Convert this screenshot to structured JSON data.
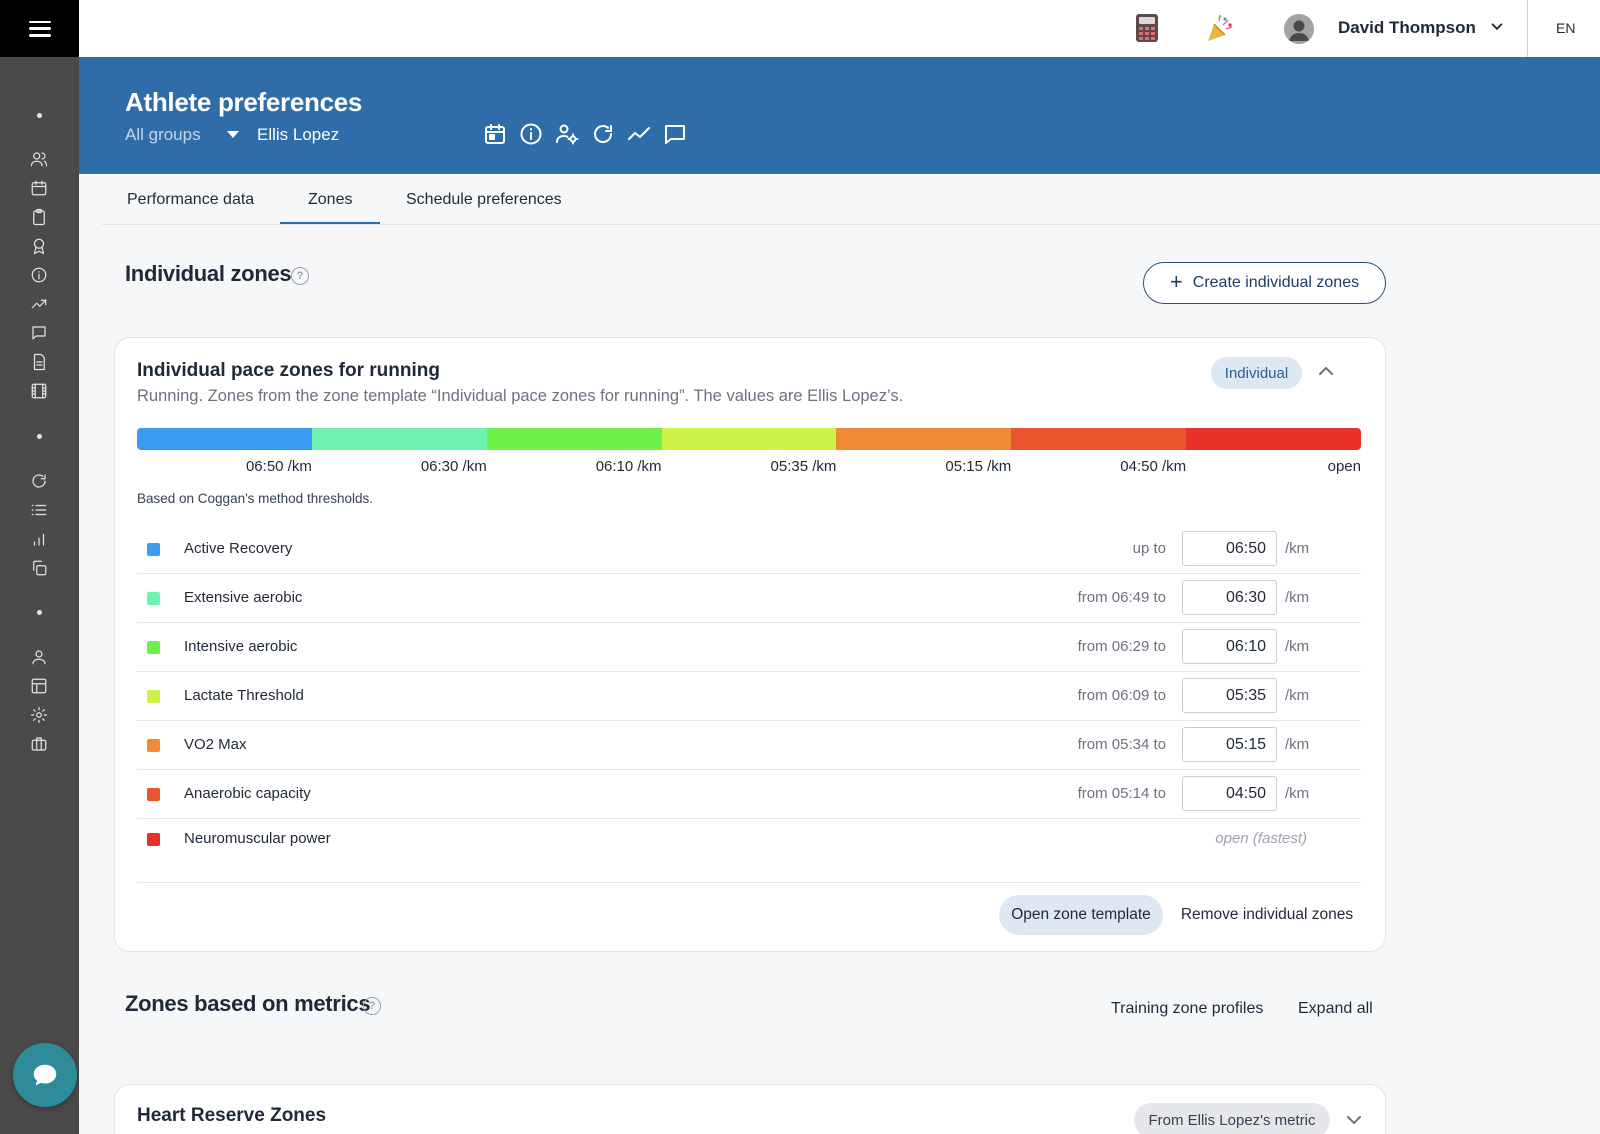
{
  "topbar": {
    "calculator_icon": "calculator-icon",
    "party_icon": "party-popper-icon",
    "user_name": "David Thompson",
    "language": "EN"
  },
  "header": {
    "title": "Athlete preferences",
    "group_select": "All groups",
    "athlete": "Ellis Lopez",
    "icons": [
      "calendar-icon",
      "info-icon",
      "user-settings-icon",
      "refresh-icon",
      "trend-icon",
      "comment-icon"
    ]
  },
  "tabs": [
    {
      "label": "Performance data",
      "active": false
    },
    {
      "label": "Zones",
      "active": true
    },
    {
      "label": "Schedule preferences",
      "active": false
    }
  ],
  "individual_zones": {
    "title": "Individual zones",
    "help": "?",
    "create_button": "Create individual zones",
    "card": {
      "title": "Individual pace zones for running",
      "subtitle": "Running. Zones from the zone template “Individual pace zones for running”. The values are Ellis Lopez’s.",
      "badge": "Individual",
      "bar_labels": [
        "06:50 /km",
        "06:30 /km",
        "06:10 /km",
        "05:35 /km",
        "05:15 /km",
        "04:50 /km",
        "open"
      ],
      "method_note": "Based on Coggan's method thresholds.",
      "zones": [
        {
          "name": "Active Recovery",
          "range": "up to",
          "value": "06:50",
          "unit": "/km",
          "color": "#3b9cf2"
        },
        {
          "name": "Extensive aerobic",
          "range": "from 06:49 to",
          "value": "06:30",
          "unit": "/km",
          "color": "#6ef2b0"
        },
        {
          "name": "Intensive aerobic",
          "range": "from 06:29 to",
          "value": "06:10",
          "unit": "/km",
          "color": "#6ef24a"
        },
        {
          "name": "Lactate Threshold",
          "range": "from 06:09 to",
          "value": "05:35",
          "unit": "/km",
          "color": "#cdf24a"
        },
        {
          "name": "VO2 Max",
          "range": "from 05:34 to",
          "value": "05:15",
          "unit": "/km",
          "color": "#ef8a35"
        },
        {
          "name": "Anaerobic capacity",
          "range": "from 05:14 to",
          "value": "04:50",
          "unit": "/km",
          "color": "#ea5530"
        },
        {
          "name": "Neuromuscular power",
          "open_text": "open (fastest)",
          "color": "#e8312a"
        }
      ],
      "open_template_button": "Open zone template",
      "remove_button": "Remove individual zones"
    }
  },
  "metric_zones": {
    "title": "Zones based on metrics",
    "help": "?",
    "profiles_link": "Training zone profiles",
    "expand_link": "Expand all",
    "card": {
      "title": "Heart Reserve Zones",
      "badge": "From Ellis Lopez's metric"
    }
  }
}
